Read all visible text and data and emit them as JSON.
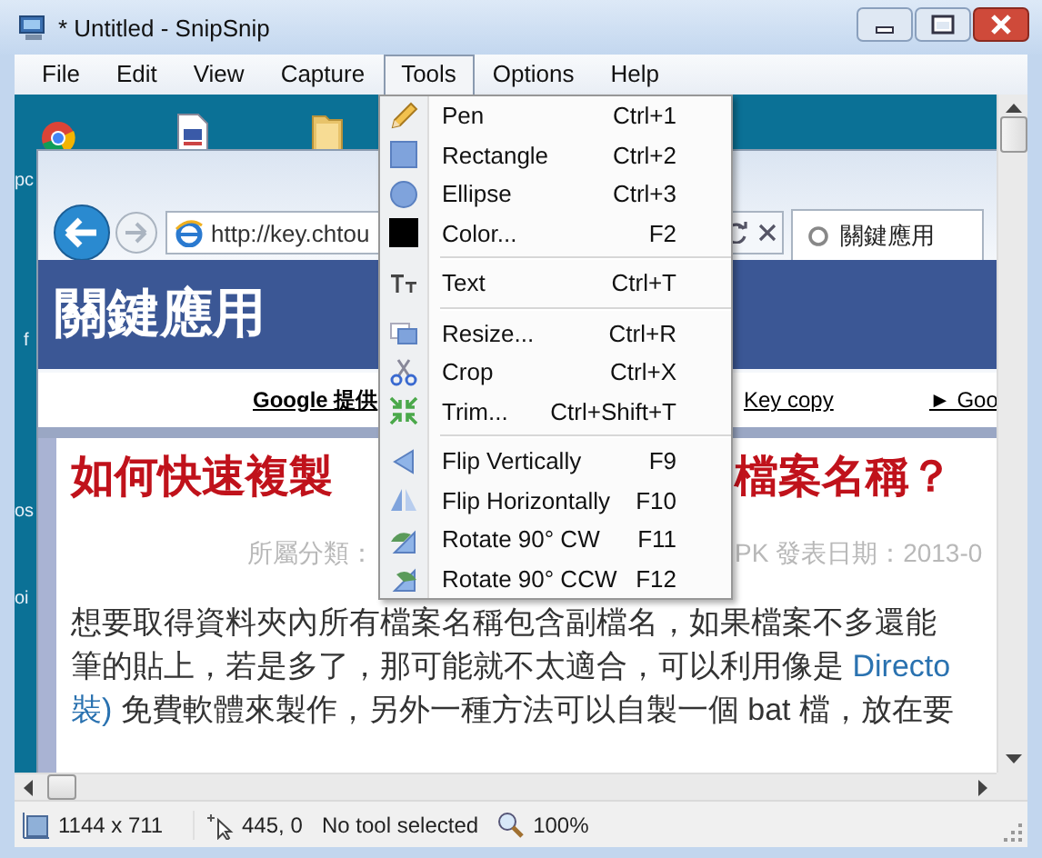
{
  "window": {
    "title": "* Untitled - SnipSnip"
  },
  "menu_bar": [
    {
      "label": "File",
      "selected": false
    },
    {
      "label": "Edit",
      "selected": false
    },
    {
      "label": "View",
      "selected": false
    },
    {
      "label": "Capture",
      "selected": false
    },
    {
      "label": "Tools",
      "selected": true
    },
    {
      "label": "Options",
      "selected": false
    },
    {
      "label": "Help",
      "selected": false
    }
  ],
  "tools_menu": [
    {
      "kind": "item",
      "label": "Pen",
      "shortcut": "Ctrl+1"
    },
    {
      "kind": "item",
      "label": "Rectangle",
      "shortcut": "Ctrl+2"
    },
    {
      "kind": "item",
      "label": "Ellipse",
      "shortcut": "Ctrl+3"
    },
    {
      "kind": "item",
      "label": "Color...",
      "shortcut": "F2"
    },
    {
      "kind": "separator"
    },
    {
      "kind": "item",
      "label": "Text",
      "shortcut": "Ctrl+T"
    },
    {
      "kind": "separator"
    },
    {
      "kind": "item",
      "label": "Resize...",
      "shortcut": "Ctrl+R"
    },
    {
      "kind": "item",
      "label": "Crop",
      "shortcut": "Ctrl+X"
    },
    {
      "kind": "item",
      "label": "Trim...",
      "shortcut": "Ctrl+Shift+T"
    },
    {
      "kind": "separator"
    },
    {
      "kind": "item",
      "label": "Flip Vertically",
      "shortcut": "F9"
    },
    {
      "kind": "item",
      "label": "Flip Horizontally",
      "shortcut": "F10"
    },
    {
      "kind": "item",
      "label": "Rotate 90° CW",
      "shortcut": "F11"
    },
    {
      "kind": "item",
      "label": "Rotate 90° CCW",
      "shortcut": "F12"
    }
  ],
  "canvas": {
    "desktop_labels": [
      "pc",
      "f",
      "os",
      "oi"
    ],
    "browser": {
      "address": "http://key.chtou",
      "tab_title": "關鍵應用",
      "site_title": "關鍵應用",
      "nav_links": [
        "Google 提供",
        "Key copy",
        "► Goo"
      ],
      "article": {
        "title_left": "如何快速複製",
        "title_right": "檔案名稱？",
        "meta_left": "所屬分類：",
        "meta_right": "PK  發表日期：2013-0",
        "lines": [
          [
            {
              "text": "想要取得資料夾內所有檔案名稱包含副檔名，如果檔案不多還能",
              "link": false
            }
          ],
          [
            {
              "text": "筆的貼上，若是多了，那可能就不太適合，可以利用像是 ",
              "link": false
            },
            {
              "text": "Directo",
              "link": true
            }
          ],
          [
            {
              "text": "裝)",
              "link": true
            },
            {
              "text": " 免費軟體來製作，另外一種方法可以自製一個 bat 檔，放在要",
              "link": false
            }
          ]
        ]
      }
    }
  },
  "status_bar": {
    "size": "1144 x 711",
    "position": "445, 0",
    "tool": "No tool selected",
    "zoom": "100%"
  }
}
